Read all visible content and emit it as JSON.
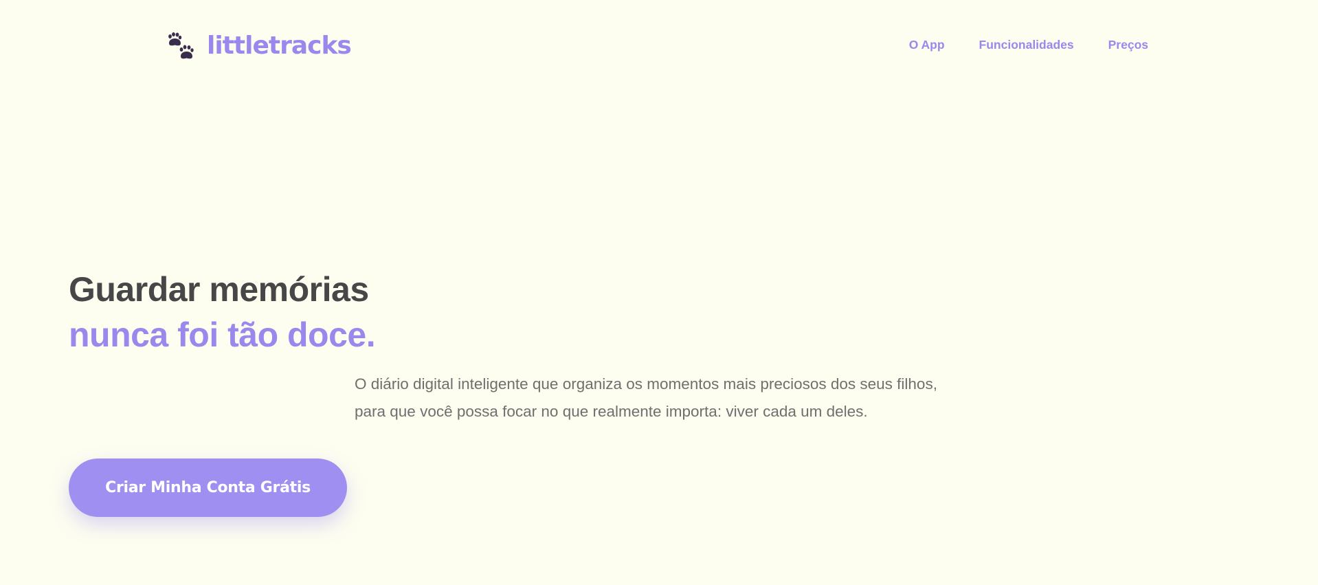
{
  "header": {
    "brand": {
      "name": "littletracks",
      "icon": "paw-prints-icon",
      "icon_color": "#3b2e4c",
      "color": "#9a88ec"
    },
    "nav": [
      {
        "label": "O App"
      },
      {
        "label": "Funcionalidades"
      },
      {
        "label": "Preços"
      }
    ]
  },
  "hero": {
    "title_line1": "Guardar memórias",
    "title_line2": "nunca foi tão doce.",
    "description": "O diário digital inteligente que organiza os momentos mais preciosos dos seus filhos, para que você possa focar no que realmente importa: viver cada um deles.",
    "cta_label": "Criar Minha Conta Grátis"
  },
  "colors": {
    "background": "#fdfdf0",
    "accent": "#9a88ec",
    "button": "#9f8ff1",
    "heading": "#474747",
    "body_text": "#6f6f6f"
  }
}
